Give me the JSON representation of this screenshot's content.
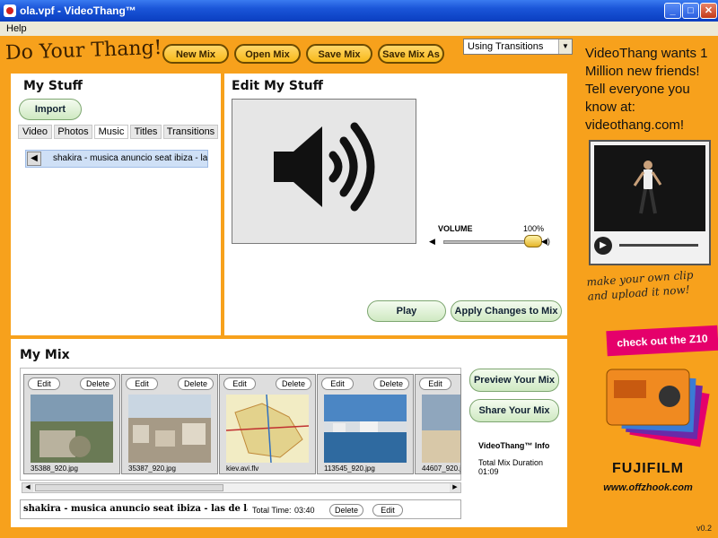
{
  "window": {
    "title": "ola.vpf - VideoThang™",
    "minimize": "_",
    "maximize": "□",
    "close": "✕"
  },
  "menu": {
    "help": "Help"
  },
  "header": {
    "logo": "Do Your Thang!",
    "buttons": {
      "new_mix": "New Mix",
      "open_mix": "Open Mix",
      "save_mix": "Save Mix",
      "save_mix_as": "Save Mix As"
    },
    "transitions_select": "Using Transitions"
  },
  "my_stuff": {
    "title": "My Stuff",
    "import_label": "Import",
    "tabs": [
      "Video",
      "Photos",
      "Music",
      "Titles",
      "Transitions"
    ],
    "active_tab": "Music",
    "items": [
      {
        "label": "shakira - musica anuncio seat ibiza - las de"
      }
    ]
  },
  "edit": {
    "title": "Edit My Stuff",
    "volume_label": "VOLUME",
    "volume_pct": "100%",
    "volume": 1.0,
    "play_label": "Play",
    "apply_label": "Apply Changes to Mix"
  },
  "mix": {
    "title": "My Mix",
    "clips": [
      {
        "caption": "35388_920.jpg",
        "edit": "Edit",
        "delete": "Delete"
      },
      {
        "caption": "35387_920.jpg",
        "edit": "Edit",
        "delete": "Delete"
      },
      {
        "caption": "kiev.avi.flv",
        "edit": "Edit",
        "delete": "Delete"
      },
      {
        "caption": "113545_920.jpg",
        "edit": "Edit",
        "delete": "Delete"
      },
      {
        "caption": "44607_920.jpg",
        "edit": "Edit",
        "delete": ""
      }
    ],
    "song": "shakira - musica anuncio seat ibiza - las de la intuici",
    "total_time_label": "Total Time:",
    "total_time": "03:40",
    "delete_label": "Delete",
    "edit_label": "Edit",
    "preview_label": "Preview Your Mix",
    "share_label": "Share Your Mix",
    "info_title": "VideoThang™ Info",
    "duration_label": "Total Mix Duration",
    "duration": "01:09"
  },
  "ad": {
    "headline": "VideoThang wants 1 Million new friends! Tell everyone you know at: videothang.com!",
    "handwritten": "make your own clip and upload it now!",
    "z10": "check out the Z10",
    "brand": "FUJIFILM",
    "url": "www.offzhook.com"
  },
  "version": "v0.2"
}
